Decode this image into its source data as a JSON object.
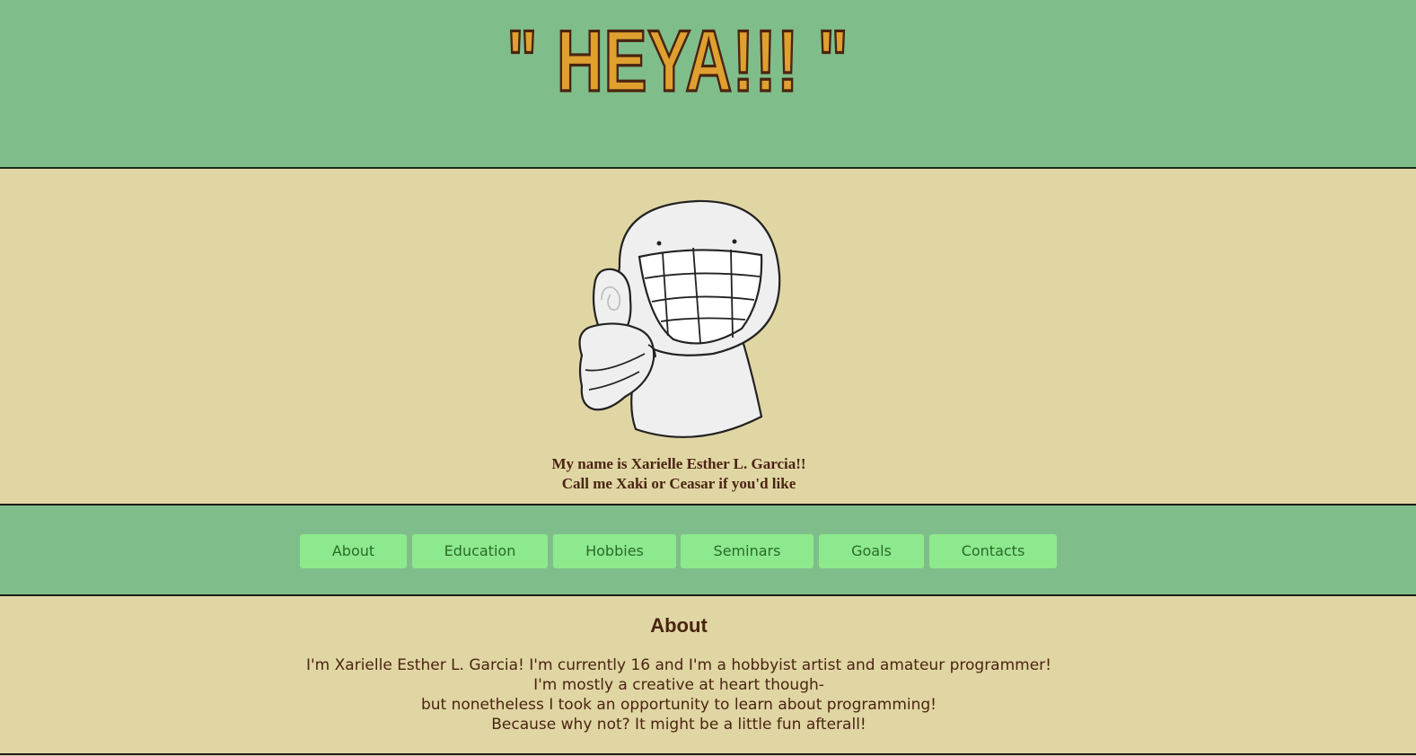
{
  "header": {
    "title": "\" HEYA!!! \""
  },
  "hero": {
    "mascot_icon": "grinning-thumbs-up-mascot",
    "intro_line1": "My name is Xarielle Esther L. Garcia!!",
    "intro_line2": "Call me Xaki or Ceasar if you'd like"
  },
  "nav": {
    "items": [
      {
        "label": "About"
      },
      {
        "label": "Education"
      },
      {
        "label": "Hobbies"
      },
      {
        "label": "Seminars"
      },
      {
        "label": "Goals"
      },
      {
        "label": "Contacts"
      }
    ]
  },
  "about": {
    "title": "About",
    "lines": [
      "I'm Xarielle Esther L. Garcia! I'm currently 16 and I'm a hobbyist artist and amateur programmer!",
      "I'm mostly a creative at heart though-",
      "but nonetheless I took an opportunity to learn about programming!",
      "Because why not? It might be a little fun afterall!"
    ]
  },
  "colors": {
    "header_bg": "#7fbe8a",
    "page_bg": "#e0d6a4",
    "title_fill": "#dfa030",
    "title_stroke": "#4a2410",
    "nav_button_bg": "#8de98d",
    "nav_button_text": "#2a6a2a",
    "body_text": "#4a2410"
  }
}
